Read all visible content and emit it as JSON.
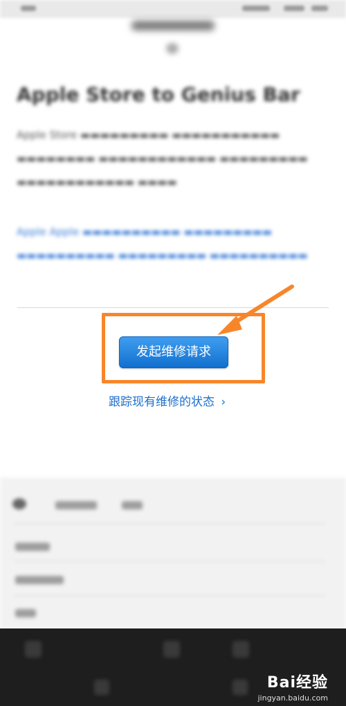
{
  "article": {
    "heading": "Apple Store to Genius Bar",
    "paragraph1": "Apple Store",
    "paragraph2": "Apple Apple"
  },
  "actions": {
    "repair_request_label": "发起维修请求",
    "track_repair_label": "跟踪现有维修的状态",
    "track_chevron": "›"
  },
  "annotation": {
    "highlight_color": "#f7862b"
  },
  "watermark": {
    "brand": "Bai经验",
    "url": "jingyan.baidu.com"
  }
}
